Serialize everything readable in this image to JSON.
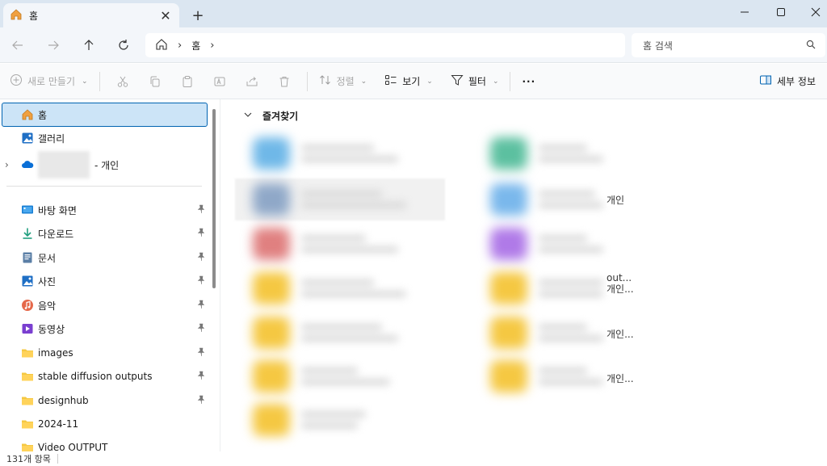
{
  "titlebar": {
    "tab_title": "홈",
    "tab_close": "✕",
    "new_tab": "+"
  },
  "nav": {
    "breadcrumb": [
      "홈"
    ],
    "search_placeholder": "홈 검색"
  },
  "toolbar": {
    "new_label": "새로 만들기",
    "sort_label": "정렬",
    "view_label": "보기",
    "filter_label": "필터",
    "more_label": "···",
    "details_label": "세부 정보"
  },
  "sidebar": {
    "top_items": [
      {
        "label": "홈",
        "icon": "home-icon",
        "selected": true
      },
      {
        "label": "갤러리",
        "icon": "gallery-icon"
      },
      {
        "label": "- 개인",
        "icon": "onedrive-cloud-icon"
      }
    ],
    "pinned_items": [
      {
        "label": "바탕 화면",
        "icon": "desktop-icon"
      },
      {
        "label": "다운로드",
        "icon": "download-icon"
      },
      {
        "label": "문서",
        "icon": "document-icon"
      },
      {
        "label": "사진",
        "icon": "pictures-icon"
      },
      {
        "label": "음악",
        "icon": "music-icon"
      },
      {
        "label": "동영상",
        "icon": "video-icon"
      },
      {
        "label": "images",
        "icon": "folder-icon"
      },
      {
        "label": "stable diffusion outputs",
        "icon": "folder-icon"
      },
      {
        "label": "designhub",
        "icon": "folder-icon"
      }
    ],
    "other_items": [
      {
        "label": "2024-11",
        "icon": "folder-icon"
      },
      {
        "label": "Video OUTPUT",
        "icon": "folder-icon"
      }
    ]
  },
  "main": {
    "section_title": "즐겨찾기",
    "favorites_left": [
      {
        "icon_color": "#6fb8e8"
      },
      {
        "icon_color": "#8fa8c8"
      },
      {
        "icon_color": "#e08080"
      },
      {
        "icon_color": "#f5c842"
      },
      {
        "icon_color": "#f5c842"
      },
      {
        "icon_color": "#f5c842"
      },
      {
        "icon_color": "#f5c842"
      }
    ],
    "favorites_right": [
      {
        "icon_color": "#5cc0a0",
        "suffix": ""
      },
      {
        "icon_color": "#7ab8ec",
        "suffix": "개인"
      },
      {
        "icon_color": "#b07ae8",
        "suffix": ""
      },
      {
        "icon_color": "#f5c842",
        "suffix": "out...\n개인..."
      },
      {
        "icon_color": "#f5c842",
        "suffix": "개인..."
      },
      {
        "icon_color": "#f5c842",
        "suffix": "개인..."
      }
    ]
  },
  "statusbar": {
    "item_count": "131개 항목"
  },
  "colors": {
    "selection": "#cce4f7",
    "accent": "#0063b1",
    "folder": "#f5c842"
  }
}
